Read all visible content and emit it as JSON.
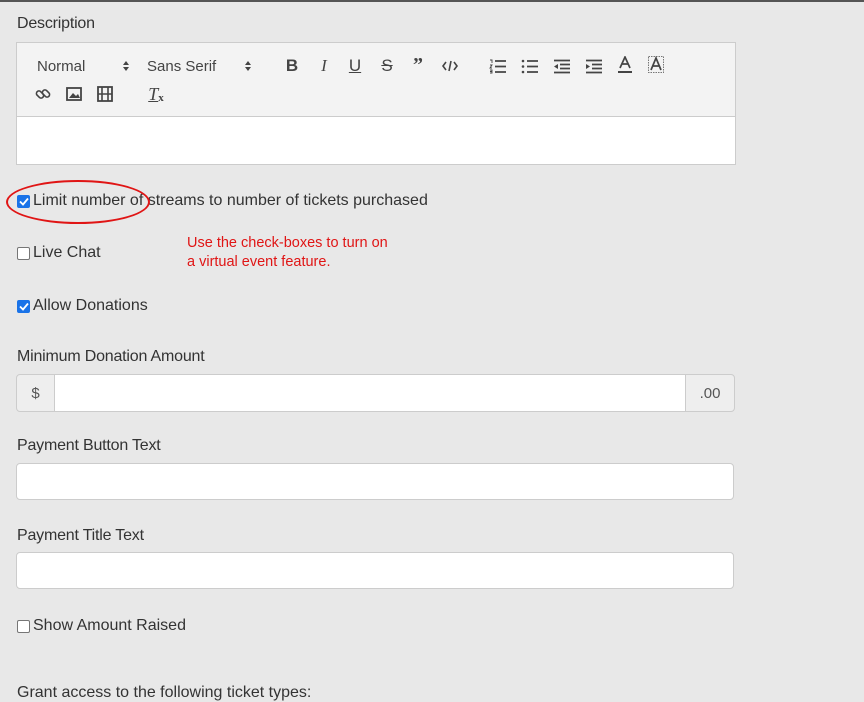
{
  "description": {
    "label": "Description",
    "toolbar": {
      "header_select": "Normal",
      "font_select": "Sans Serif",
      "icons": [
        "bold-icon",
        "italic-icon",
        "underline-icon",
        "strike-icon",
        "blockquote-icon",
        "code-icon",
        "ordered-list-icon",
        "bullet-list-icon",
        "outdent-icon",
        "indent-icon",
        "text-color-icon",
        "background-color-icon",
        "link-icon",
        "image-icon",
        "video-icon",
        "clear-format-icon"
      ]
    }
  },
  "checkboxes": {
    "limit_streams": {
      "label": "Limit number of streams to number of tickets purchased",
      "checked": true
    },
    "live_chat": {
      "label": "Live Chat",
      "checked": false
    },
    "allow_donations": {
      "label": "Allow Donations",
      "checked": true
    },
    "show_amount_raised": {
      "label": "Show Amount Raised",
      "checked": false
    }
  },
  "annotation": {
    "line1": "Use the check-boxes to turn on",
    "line2": "a virtual event feature."
  },
  "min_donation": {
    "label": "Minimum Donation Amount",
    "prefix": "$",
    "suffix": ".00",
    "value": ""
  },
  "payment_button": {
    "label": "Payment Button Text",
    "value": ""
  },
  "payment_title": {
    "label": "Payment Title Text",
    "value": ""
  },
  "grant_access": {
    "label": "Grant access to the following ticket types:"
  },
  "colors": {
    "annotation_red": "#e01515",
    "checkbox_blue": "#1a73e8",
    "page_bg": "#e8e8e8"
  }
}
